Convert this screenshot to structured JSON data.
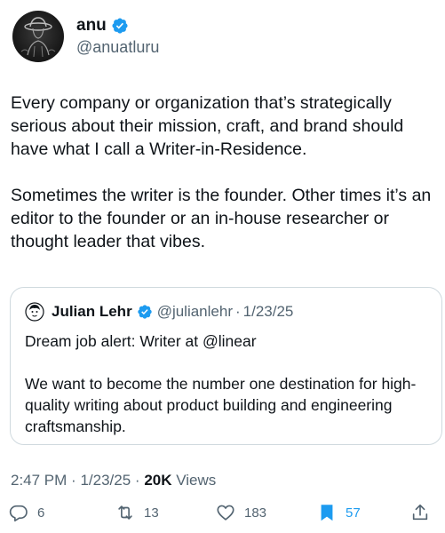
{
  "author": {
    "display_name": "anu",
    "handle": "@anuatluru",
    "verified": true
  },
  "tweet": {
    "paragraphs": [
      "Every company or organization that’s strategically serious about their mission, craft, and brand should have what I call a Writer-in-Residence.",
      "Sometimes the writer is the founder. Other times it’s an editor to the founder or an in-house researcher or thought leader that vibes."
    ]
  },
  "quote": {
    "display_name": "Julian Lehr",
    "handle": "@julianlehr",
    "separator": "·",
    "date": "1/23/25",
    "paragraphs": [
      "Dream job alert: Writer at @linear",
      "We want to become the number one destination for high-quality writing about product building and engineering craftsmanship."
    ]
  },
  "meta": {
    "time": "2:47 PM",
    "separator": "·",
    "date": "1/23/25",
    "views_count": "20K",
    "views_label": "Views"
  },
  "actions": {
    "replies": "6",
    "retweets": "13",
    "likes": "183",
    "bookmarks": "57"
  },
  "colors": {
    "accent": "#1d9bf0",
    "text": "#0f1419",
    "secondary": "#536471",
    "border": "#cfd9de"
  },
  "icons": [
    "verified-badge-icon",
    "reply-icon",
    "retweet-icon",
    "like-icon",
    "bookmark-icon",
    "share-icon"
  ]
}
